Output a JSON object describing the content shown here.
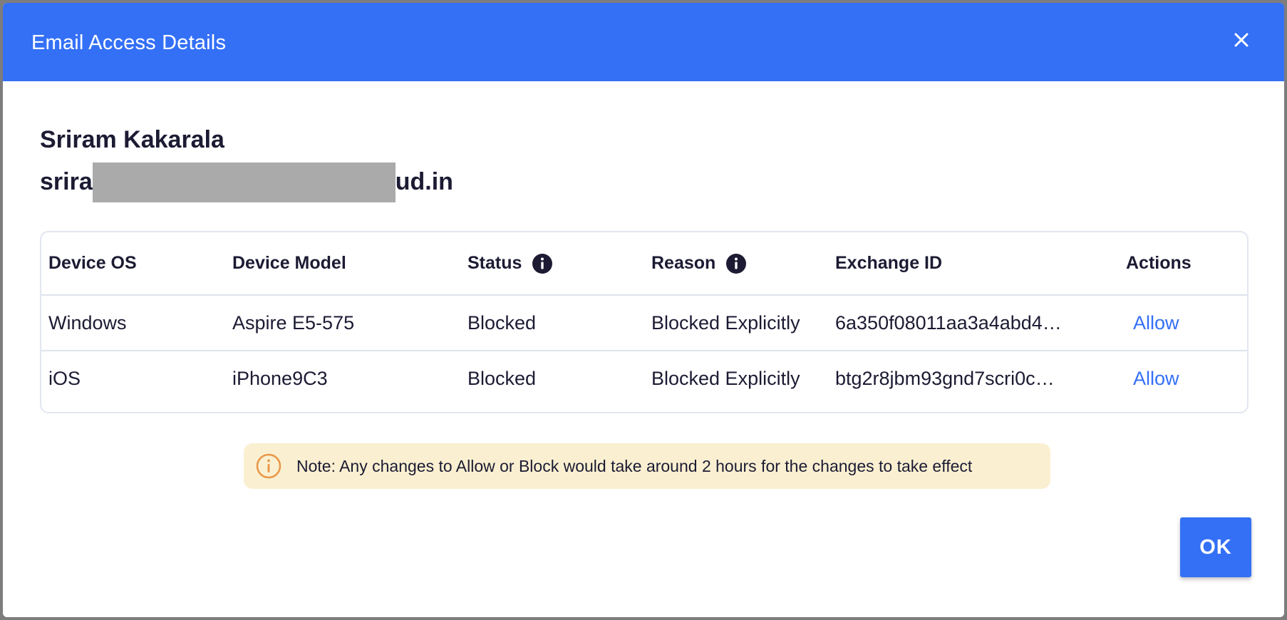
{
  "modal": {
    "title": "Email Access Details",
    "close_icon": "close-icon"
  },
  "user": {
    "name": "Sriram Kakarala",
    "email_prefix": "srira",
    "email_suffix": "ud.in"
  },
  "table": {
    "headers": [
      "Device OS",
      "Device Model",
      "Status",
      "Reason",
      "Exchange ID",
      "Actions"
    ],
    "rows": [
      {
        "os": "Windows",
        "model": "Aspire E5-575",
        "status": "Blocked",
        "reason": "Blocked Explicitly",
        "exchange_id": "6a350f08011aa3a4abd4…",
        "action": "Allow"
      },
      {
        "os": "iOS",
        "model": "iPhone9C3",
        "status": "Blocked",
        "reason": "Blocked Explicitly",
        "exchange_id": "btg2r8jbm93gnd7scri0c…",
        "action": "Allow"
      }
    ]
  },
  "note": {
    "text": "Note: Any changes to Allow or Block would take around 2 hours for the changes to take effect"
  },
  "footer": {
    "ok_label": "OK"
  },
  "colors": {
    "header_blue": "#3470f6",
    "note_background": "#faf0d1",
    "note_icon": "#e9984a",
    "link_blue": "#3470f6"
  }
}
